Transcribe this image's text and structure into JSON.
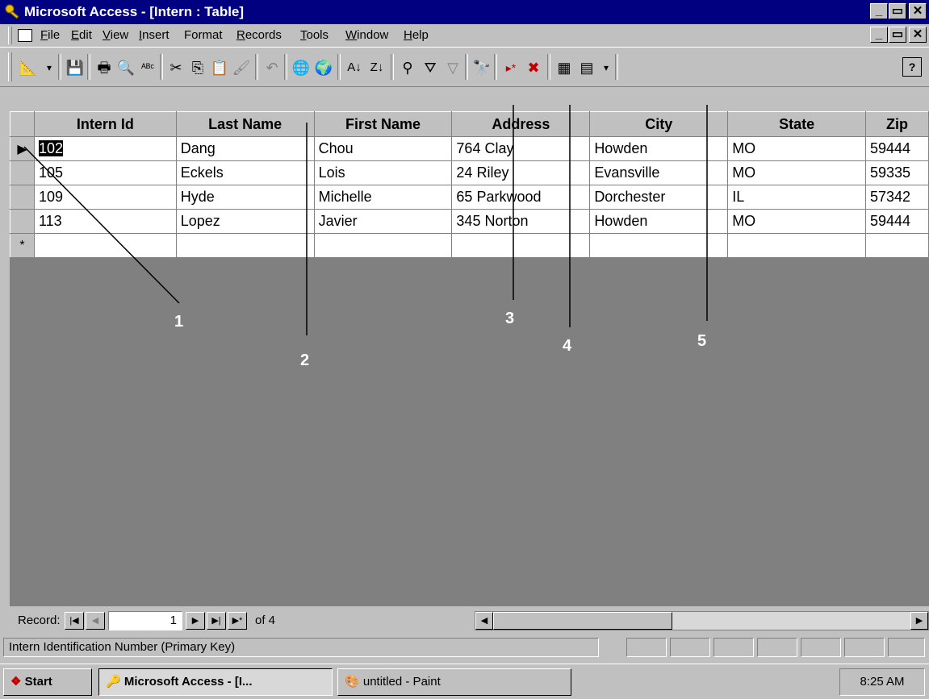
{
  "window": {
    "title": "Microsoft Access - [Intern : Table]",
    "min": "_",
    "restore": "▭",
    "close": "✕"
  },
  "menu": {
    "items": [
      {
        "underline": "F",
        "rest": "ile"
      },
      {
        "underline": "E",
        "rest": "dit"
      },
      {
        "underline": "V",
        "rest": "iew"
      },
      {
        "underline": "I",
        "rest": "nsert"
      },
      {
        "underline": "",
        "rest": "Format"
      },
      {
        "underline": "R",
        "rest": "ecords"
      },
      {
        "underline": "T",
        "rest": "ools"
      },
      {
        "underline": "W",
        "rest": "indow"
      },
      {
        "underline": "H",
        "rest": "elp"
      }
    ]
  },
  "toolbar": {
    "icons": [
      "view-icon",
      "save-icon",
      "print-icon",
      "print-preview-icon",
      "spelling-icon",
      "cut-icon",
      "copy-icon",
      "paste-icon",
      "format-painter-icon",
      "undo-icon",
      "insert-hyperlink-icon",
      "web-toolbar-icon",
      "sort-ascending-icon",
      "sort-descending-icon",
      "filter-by-selection-icon",
      "filter-by-form-icon",
      "apply-filter-icon",
      "find-icon",
      "new-record-icon",
      "delete-record-icon",
      "database-window-icon",
      "new-object-icon",
      "help-icon"
    ]
  },
  "table": {
    "columns": [
      "Intern Id",
      "Last Name",
      "First Name",
      "Address",
      "City",
      "State",
      "Zip"
    ],
    "rows": [
      [
        "102",
        "Dang",
        "Chou",
        "764 Clay",
        "Howden",
        "MO",
        "59444"
      ],
      [
        "105",
        "Eckels",
        "Lois",
        "24 Riley",
        "Evansville",
        "MO",
        "59335"
      ],
      [
        "109",
        "Hyde",
        "Michelle",
        "65 Parkwood",
        "Dorchester",
        "IL",
        "57342"
      ],
      [
        "113",
        "Lopez",
        "Javier",
        "345 Norton",
        "Howden",
        "MO",
        "59444"
      ]
    ],
    "new_row_marker": "*",
    "current_row_marker": "▶"
  },
  "navigation": {
    "label": "Record:",
    "current": "1",
    "of_label": "of 4"
  },
  "status": {
    "text": "Intern Identification Number (Primary Key)"
  },
  "taskbar": {
    "start": "Start",
    "task1": "Microsoft Access - [I...",
    "task2": "untitled - Paint",
    "clock": "8:25 AM"
  },
  "callouts": [
    "1",
    "2",
    "3",
    "4",
    "5"
  ]
}
